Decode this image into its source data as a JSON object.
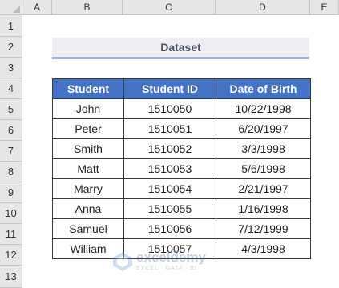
{
  "columns": [
    "A",
    "B",
    "C",
    "D",
    "E"
  ],
  "rows": [
    "1",
    "2",
    "3",
    "4",
    "5",
    "6",
    "7",
    "8",
    "9",
    "10",
    "11",
    "12",
    "13"
  ],
  "title": "Dataset",
  "table": {
    "headers": [
      "Student",
      "Student ID",
      "Date of Birth"
    ],
    "rows": [
      [
        "John",
        "1510050",
        "10/22/1998"
      ],
      [
        "Peter",
        "1510051",
        "6/20/1997"
      ],
      [
        "Smith",
        "1510052",
        "3/3/1998"
      ],
      [
        "Matt",
        "1510053",
        "5/6/1998"
      ],
      [
        "Marry",
        "1510054",
        "2/21/1997"
      ],
      [
        "Anna",
        "1510055",
        "1/16/1998"
      ],
      [
        "Samuel",
        "1510056",
        "7/12/1999"
      ],
      [
        "William",
        "1510057",
        "4/3/1998"
      ]
    ]
  },
  "watermark": {
    "name": "exceldemy",
    "tagline": "EXCEL · DATA · BI"
  },
  "colors": {
    "header_fill": "#4472c4",
    "title_fill": "#efeff3",
    "title_underline": "#9db3e0"
  }
}
